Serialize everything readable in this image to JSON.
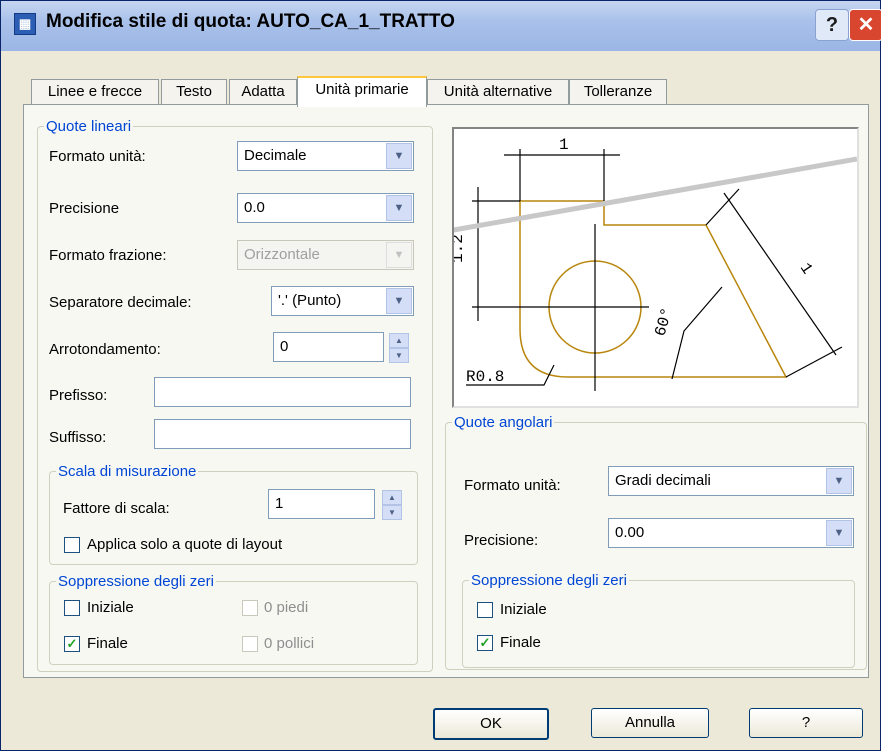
{
  "window": {
    "title": "Modifica stile di quota: AUTO_CA_1_TRATTO",
    "help_btn": "?",
    "close_btn": "✕"
  },
  "tabs": [
    {
      "label": "Linee e frecce",
      "active": false
    },
    {
      "label": "Testo",
      "active": false
    },
    {
      "label": "Adatta",
      "active": false
    },
    {
      "label": "Unità primarie",
      "active": true
    },
    {
      "label": "Unità alternative",
      "active": false
    },
    {
      "label": "Tolleranze",
      "active": false
    }
  ],
  "linear": {
    "legend": "Quote lineari",
    "unit_format": {
      "label": "Formato unità:",
      "value": "Decimale"
    },
    "precision": {
      "label": "Precisione",
      "value": "0.0"
    },
    "fraction_format": {
      "label": "Formato frazione:",
      "value": "Orizzontale"
    },
    "decimal_sep": {
      "label": "Separatore decimale:",
      "value": "'.' (Punto)"
    },
    "round_off": {
      "label": "Arrotondamento:",
      "value": "0"
    },
    "prefix": {
      "label": "Prefisso:",
      "value": ""
    },
    "suffix": {
      "label": "Suffisso:",
      "value": ""
    }
  },
  "scale": {
    "legend": "Scala di misurazione",
    "factor": {
      "label": "Fattore di scala:",
      "value": "1"
    },
    "layout_only": {
      "label": "Applica solo a quote di layout",
      "checked": false
    }
  },
  "zero_linear": {
    "legend": "Soppressione degli zeri",
    "leading": {
      "label": "Iniziale",
      "checked": false
    },
    "trailing": {
      "label": "Finale",
      "checked": true
    },
    "feet": {
      "label": "0 piedi",
      "checked": false
    },
    "inches": {
      "label": "0 pollici",
      "checked": false
    }
  },
  "angular": {
    "legend": "Quote angolari",
    "unit_format": {
      "label": "Formato unità:",
      "value": "Gradi decimali"
    },
    "precision": {
      "label": "Precisione:",
      "value": "0.00"
    }
  },
  "zero_angular": {
    "legend": "Soppressione degli zeri",
    "leading": {
      "label": "Iniziale",
      "checked": false
    },
    "trailing": {
      "label": "Finale",
      "checked": true
    }
  },
  "preview": {
    "dim_top": "1",
    "dim_left": "1.2",
    "dim_right": "1",
    "dim_angle": "60°",
    "dim_radius": "R0.8"
  },
  "buttons": {
    "ok": "OK",
    "cancel": "Annulla",
    "help": "?"
  },
  "check_mark": "✓",
  "colors": {
    "accent": "#0046d5",
    "part": "#b8860b"
  }
}
